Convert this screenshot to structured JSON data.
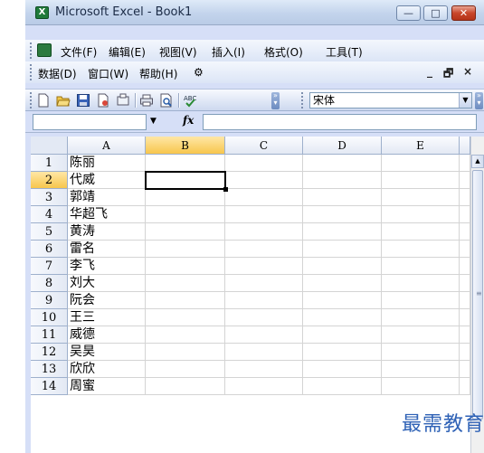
{
  "window": {
    "title": "Microsoft Excel - Book1",
    "app_icon_letter": "X",
    "minimize": "—",
    "maximize": "□",
    "close": "✕"
  },
  "menu": {
    "row1": [
      "文件(F)",
      "编辑(E)",
      "视图(V)",
      "插入(I)",
      "格式(O)",
      "工具(T)"
    ],
    "row2": [
      "数据(D)",
      "窗口(W)",
      "帮助(H)"
    ],
    "row2_extra_icon": "⚙",
    "mdi_min": "_",
    "mdi_restore": "🗗",
    "mdi_close": "×"
  },
  "toolbar": {
    "icons": [
      "new-icon",
      "open-icon",
      "save-icon",
      "permission-icon",
      "print-icon",
      "print-preview-icon",
      "spelling-icon"
    ],
    "font_name": "宋体"
  },
  "formula_bar": {
    "name_box": "",
    "fx_label": "fx",
    "formula": ""
  },
  "grid": {
    "columns": [
      "A",
      "B",
      "C",
      "D",
      "E"
    ],
    "active_column": "B",
    "active_row": "2",
    "rows": [
      {
        "num": "1",
        "A": "陈丽"
      },
      {
        "num": "2",
        "A": "代威"
      },
      {
        "num": "3",
        "A": "郭靖"
      },
      {
        "num": "4",
        "A": "华超飞"
      },
      {
        "num": "5",
        "A": "黄涛"
      },
      {
        "num": "6",
        "A": "雷名"
      },
      {
        "num": "7",
        "A": "李飞"
      },
      {
        "num": "8",
        "A": "刘大"
      },
      {
        "num": "9",
        "A": "阮会"
      },
      {
        "num": "10",
        "A": "王三"
      },
      {
        "num": "11",
        "A": "威德"
      },
      {
        "num": "12",
        "A": "吴昊"
      },
      {
        "num": "13",
        "A": "欣欣"
      },
      {
        "num": "14",
        "A": "周蜜"
      }
    ]
  },
  "watermark": "最需教育"
}
